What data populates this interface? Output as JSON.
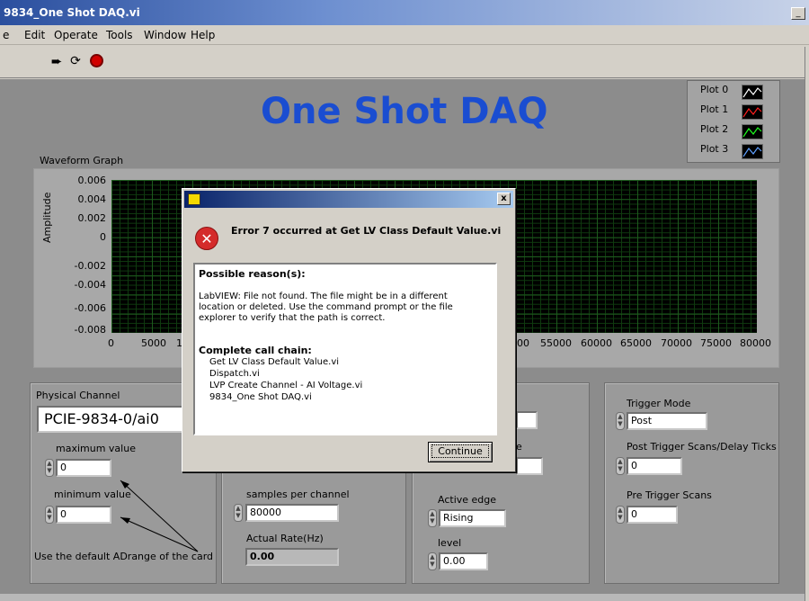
{
  "window": {
    "title": "9834_One Shot DAQ.vi"
  },
  "menu": [
    "e",
    "Edit",
    "Operate",
    "Tools",
    "Window",
    "Help"
  ],
  "toolbar": {
    "icons": [
      "run-arrow-icon",
      "run-continuous-icon",
      "abort-stop-icon"
    ]
  },
  "panel": {
    "title": "One Shot DAQ"
  },
  "legend": {
    "plots": [
      {
        "name": "Plot 0",
        "color": "#ffffff"
      },
      {
        "name": "Plot 1",
        "color": "#ff2020"
      },
      {
        "name": "Plot 2",
        "color": "#20ff20"
      },
      {
        "name": "Plot 3",
        "color": "#60a0ff"
      }
    ]
  },
  "graph": {
    "label": "Waveform Graph",
    "ylabel": "Amplitude",
    "yticks": [
      "0.006",
      "0.004",
      "0.002",
      "0",
      "-0.002",
      "-0.004",
      "-0.006",
      "-0.008"
    ],
    "xticks": [
      "0",
      "5000",
      "1",
      "00",
      "55000",
      "60000",
      "65000",
      "70000",
      "75000",
      "80000"
    ]
  },
  "channel_group": {
    "physical_channel_label": "Physical Channel",
    "physical_channel_value": "PCIE-9834-0/ai0",
    "max_label": "maximum value",
    "max_value": "0",
    "min_label": "minimum value",
    "min_value": "0",
    "note": "Use the default ADrange of the card"
  },
  "timing_group": {
    "samples_label": "samples per channel",
    "samples_value": "80000",
    "rate_label": "Actual Rate(Hz)",
    "rate_value": "0.00"
  },
  "trigger_group": {
    "edge_fragment": "e",
    "active_edge_label": "Active edge",
    "active_edge_value": "Rising",
    "level_label": "level",
    "level_value": "0.00"
  },
  "trigger_mode_group": {
    "mode_label": "Trigger Mode",
    "mode_value": "Post",
    "post_label": "Post Trigger Scans/Delay Ticks",
    "post_value": "0",
    "pre_label": "Pre Trigger Scans",
    "pre_value": "0"
  },
  "dialog": {
    "heading": "Error 7 occurred at Get LV Class Default Value.vi",
    "reason_title": "Possible reason(s):",
    "reason_text": "LabVIEW:  File not found. The file might be in a different location or deleted. Use the command prompt or the file explorer to verify that the path is correct.",
    "chain_title": "Complete call chain:",
    "chain": [
      "Get LV Class Default Value.vi",
      "Dispatch.vi",
      "LVP Create Channel - AI Voltage.vi",
      "9834_One Shot DAQ.vi"
    ],
    "button": "Continue",
    "close": "x"
  }
}
